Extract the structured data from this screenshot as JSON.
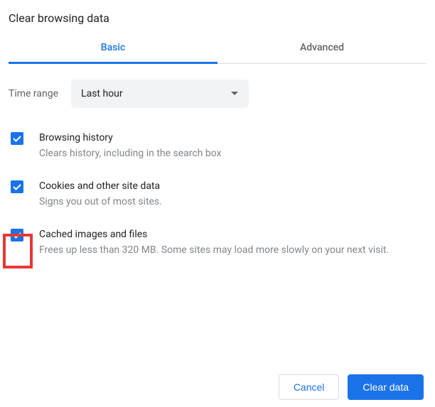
{
  "dialog": {
    "title": "Clear browsing data"
  },
  "tabs": {
    "basic": "Basic",
    "advanced": "Advanced"
  },
  "timeRange": {
    "label": "Time range",
    "value": "Last hour"
  },
  "options": [
    {
      "title": "Browsing history",
      "desc": "Clears history, including in the search box"
    },
    {
      "title": "Cookies and other site data",
      "desc": "Signs you out of most sites."
    },
    {
      "title": "Cached images and files",
      "desc": "Frees up less than 320 MB. Some sites may load more slowly on your next visit."
    }
  ],
  "buttons": {
    "cancel": "Cancel",
    "clear": "Clear data"
  }
}
